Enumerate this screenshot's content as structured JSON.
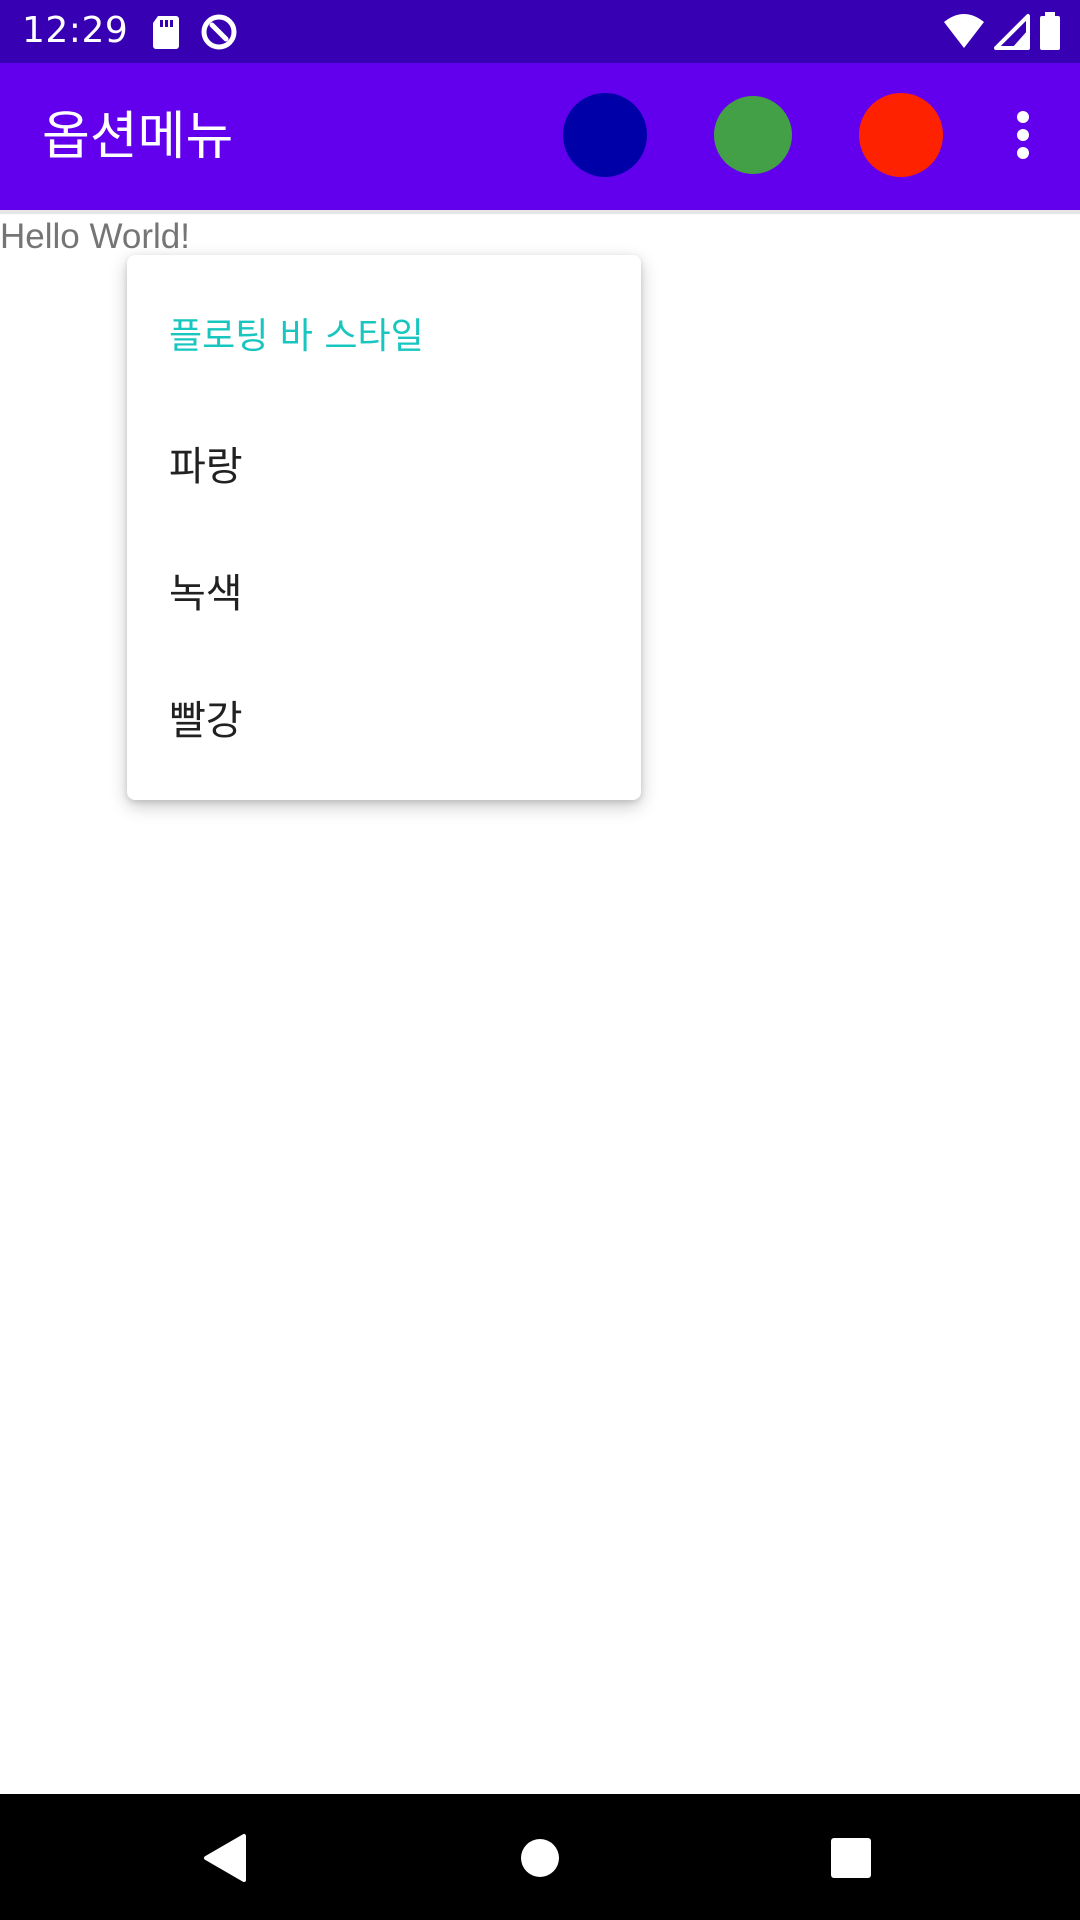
{
  "status_bar": {
    "time": "12:29",
    "icons_left": [
      "sd-card-icon",
      "data-saver-icon"
    ],
    "icons_right": [
      "wifi-icon",
      "cell-signal-icon",
      "battery-icon"
    ]
  },
  "app_bar": {
    "title": "옵션메뉴",
    "actions": [
      {
        "name": "blue",
        "color": "#0000a8"
      },
      {
        "name": "green",
        "color": "#43a047"
      },
      {
        "name": "red",
        "color": "#ff2200"
      }
    ],
    "overflow_icon": "more-vert-icon"
  },
  "content": {
    "hello": "Hello World!"
  },
  "popup_menu": {
    "header": "플로팅 바 스타일",
    "items": [
      {
        "label": "파랑"
      },
      {
        "label": "녹색"
      },
      {
        "label": "빨강"
      }
    ]
  },
  "nav_bar": {
    "buttons": [
      "back-icon",
      "home-icon",
      "recents-icon"
    ]
  },
  "colors": {
    "status_bar": "#3700b3",
    "app_bar": "#6200ee",
    "menu_header": "#18c6c0"
  }
}
